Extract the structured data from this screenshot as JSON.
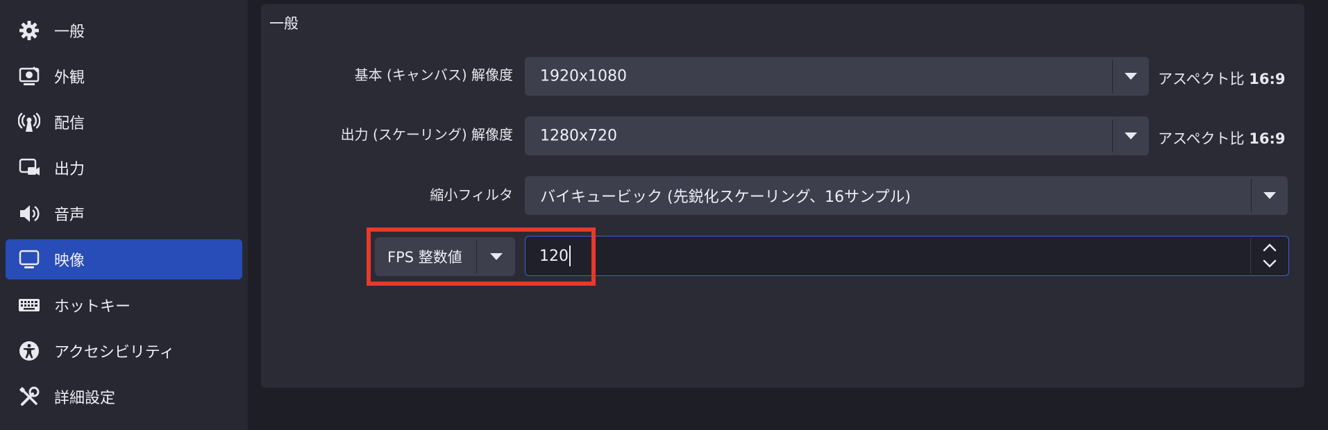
{
  "sidebar": {
    "items": [
      {
        "label": "一般",
        "icon": "gear-icon",
        "active": false
      },
      {
        "label": "外観",
        "icon": "appearance-icon",
        "active": false
      },
      {
        "label": "配信",
        "icon": "antenna-icon",
        "active": false
      },
      {
        "label": "出力",
        "icon": "output-icon",
        "active": false
      },
      {
        "label": "音声",
        "icon": "speaker-icon",
        "active": false
      },
      {
        "label": "映像",
        "icon": "monitor-icon",
        "active": true
      },
      {
        "label": "ホットキー",
        "icon": "keyboard-icon",
        "active": false
      },
      {
        "label": "アクセシビリティ",
        "icon": "accessibility-icon",
        "active": false
      },
      {
        "label": "詳細設定",
        "icon": "tools-icon",
        "active": false
      }
    ]
  },
  "main": {
    "section_title": "一般",
    "base_resolution": {
      "label": "基本 (キャンバス) 解像度",
      "value": "1920x1080",
      "aspect_prefix": "アスペクト比",
      "aspect_value": "16:9"
    },
    "output_resolution": {
      "label": "出力 (スケーリング) 解像度",
      "value": "1280x720",
      "aspect_prefix": "アスペクト比",
      "aspect_value": "16:9"
    },
    "downscale_filter": {
      "label": "縮小フィルタ",
      "value": "バイキュービック (先鋭化スケーリング、16サンプル)"
    },
    "fps": {
      "type_value": "FPS 整数値",
      "value": "120"
    }
  },
  "colors": {
    "accent": "#284cb8",
    "highlight": "#e8392b",
    "focus_border": "#3b63d6"
  }
}
